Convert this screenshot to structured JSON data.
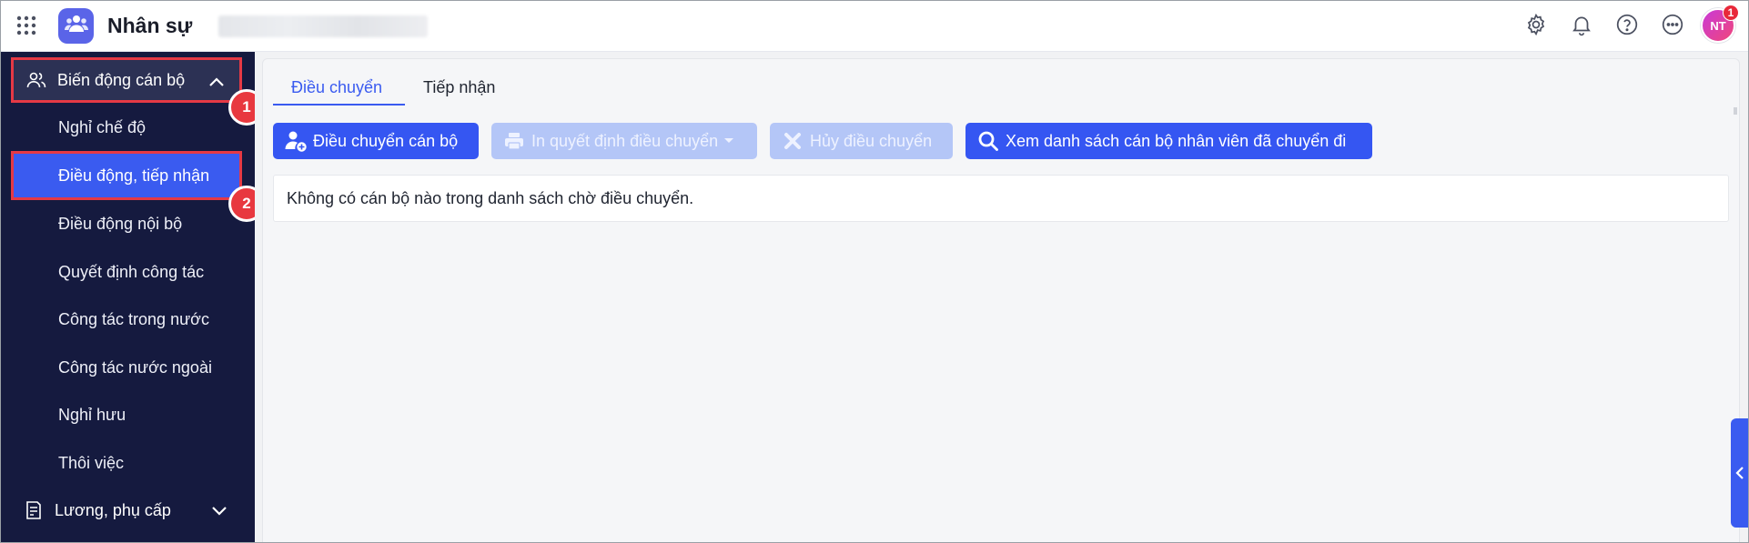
{
  "app": {
    "title": "Nhân sự"
  },
  "header": {
    "avatar_initials": "NT",
    "notification_count": "1",
    "icons": [
      "settings-icon",
      "bell-icon",
      "help-icon",
      "more-icon"
    ]
  },
  "sidebar": {
    "groups": [
      {
        "label": "Biến động cán bộ",
        "icon": "users-icon",
        "expanded": true
      },
      {
        "label": "Lương, phụ cấp",
        "icon": "document-icon",
        "expanded": false
      }
    ],
    "items": [
      {
        "label": "Nghỉ chế độ"
      },
      {
        "label": "Điều động, tiếp nhận",
        "active": true
      },
      {
        "label": "Điều động nội bộ"
      },
      {
        "label": "Quyết định công tác"
      },
      {
        "label": "Công tác trong nước"
      },
      {
        "label": "Công tác nước ngoài"
      },
      {
        "label": "Nghỉ hưu"
      },
      {
        "label": "Thôi việc"
      }
    ]
  },
  "callouts": [
    "1",
    "2"
  ],
  "main": {
    "tabs": [
      {
        "label": "Điều chuyển",
        "active": true
      },
      {
        "label": "Tiếp nhận",
        "active": false
      }
    ],
    "toolbar": {
      "transfer_label": "Điều chuyển cán bộ",
      "print_label": "In quyết định điều chuyển",
      "cancel_label": "Hủy điều chuyển",
      "view_list_label": "Xem danh sách cán bộ nhân viên đã chuyển đi"
    },
    "empty_message": "Không có cán bộ nào trong danh sách chờ điều chuyển."
  },
  "colors": {
    "sidebar_bg": "#151a3f",
    "accent": "#3a5bf0",
    "callout": "#e8383f",
    "disabled_button": "#b4c6f7"
  }
}
